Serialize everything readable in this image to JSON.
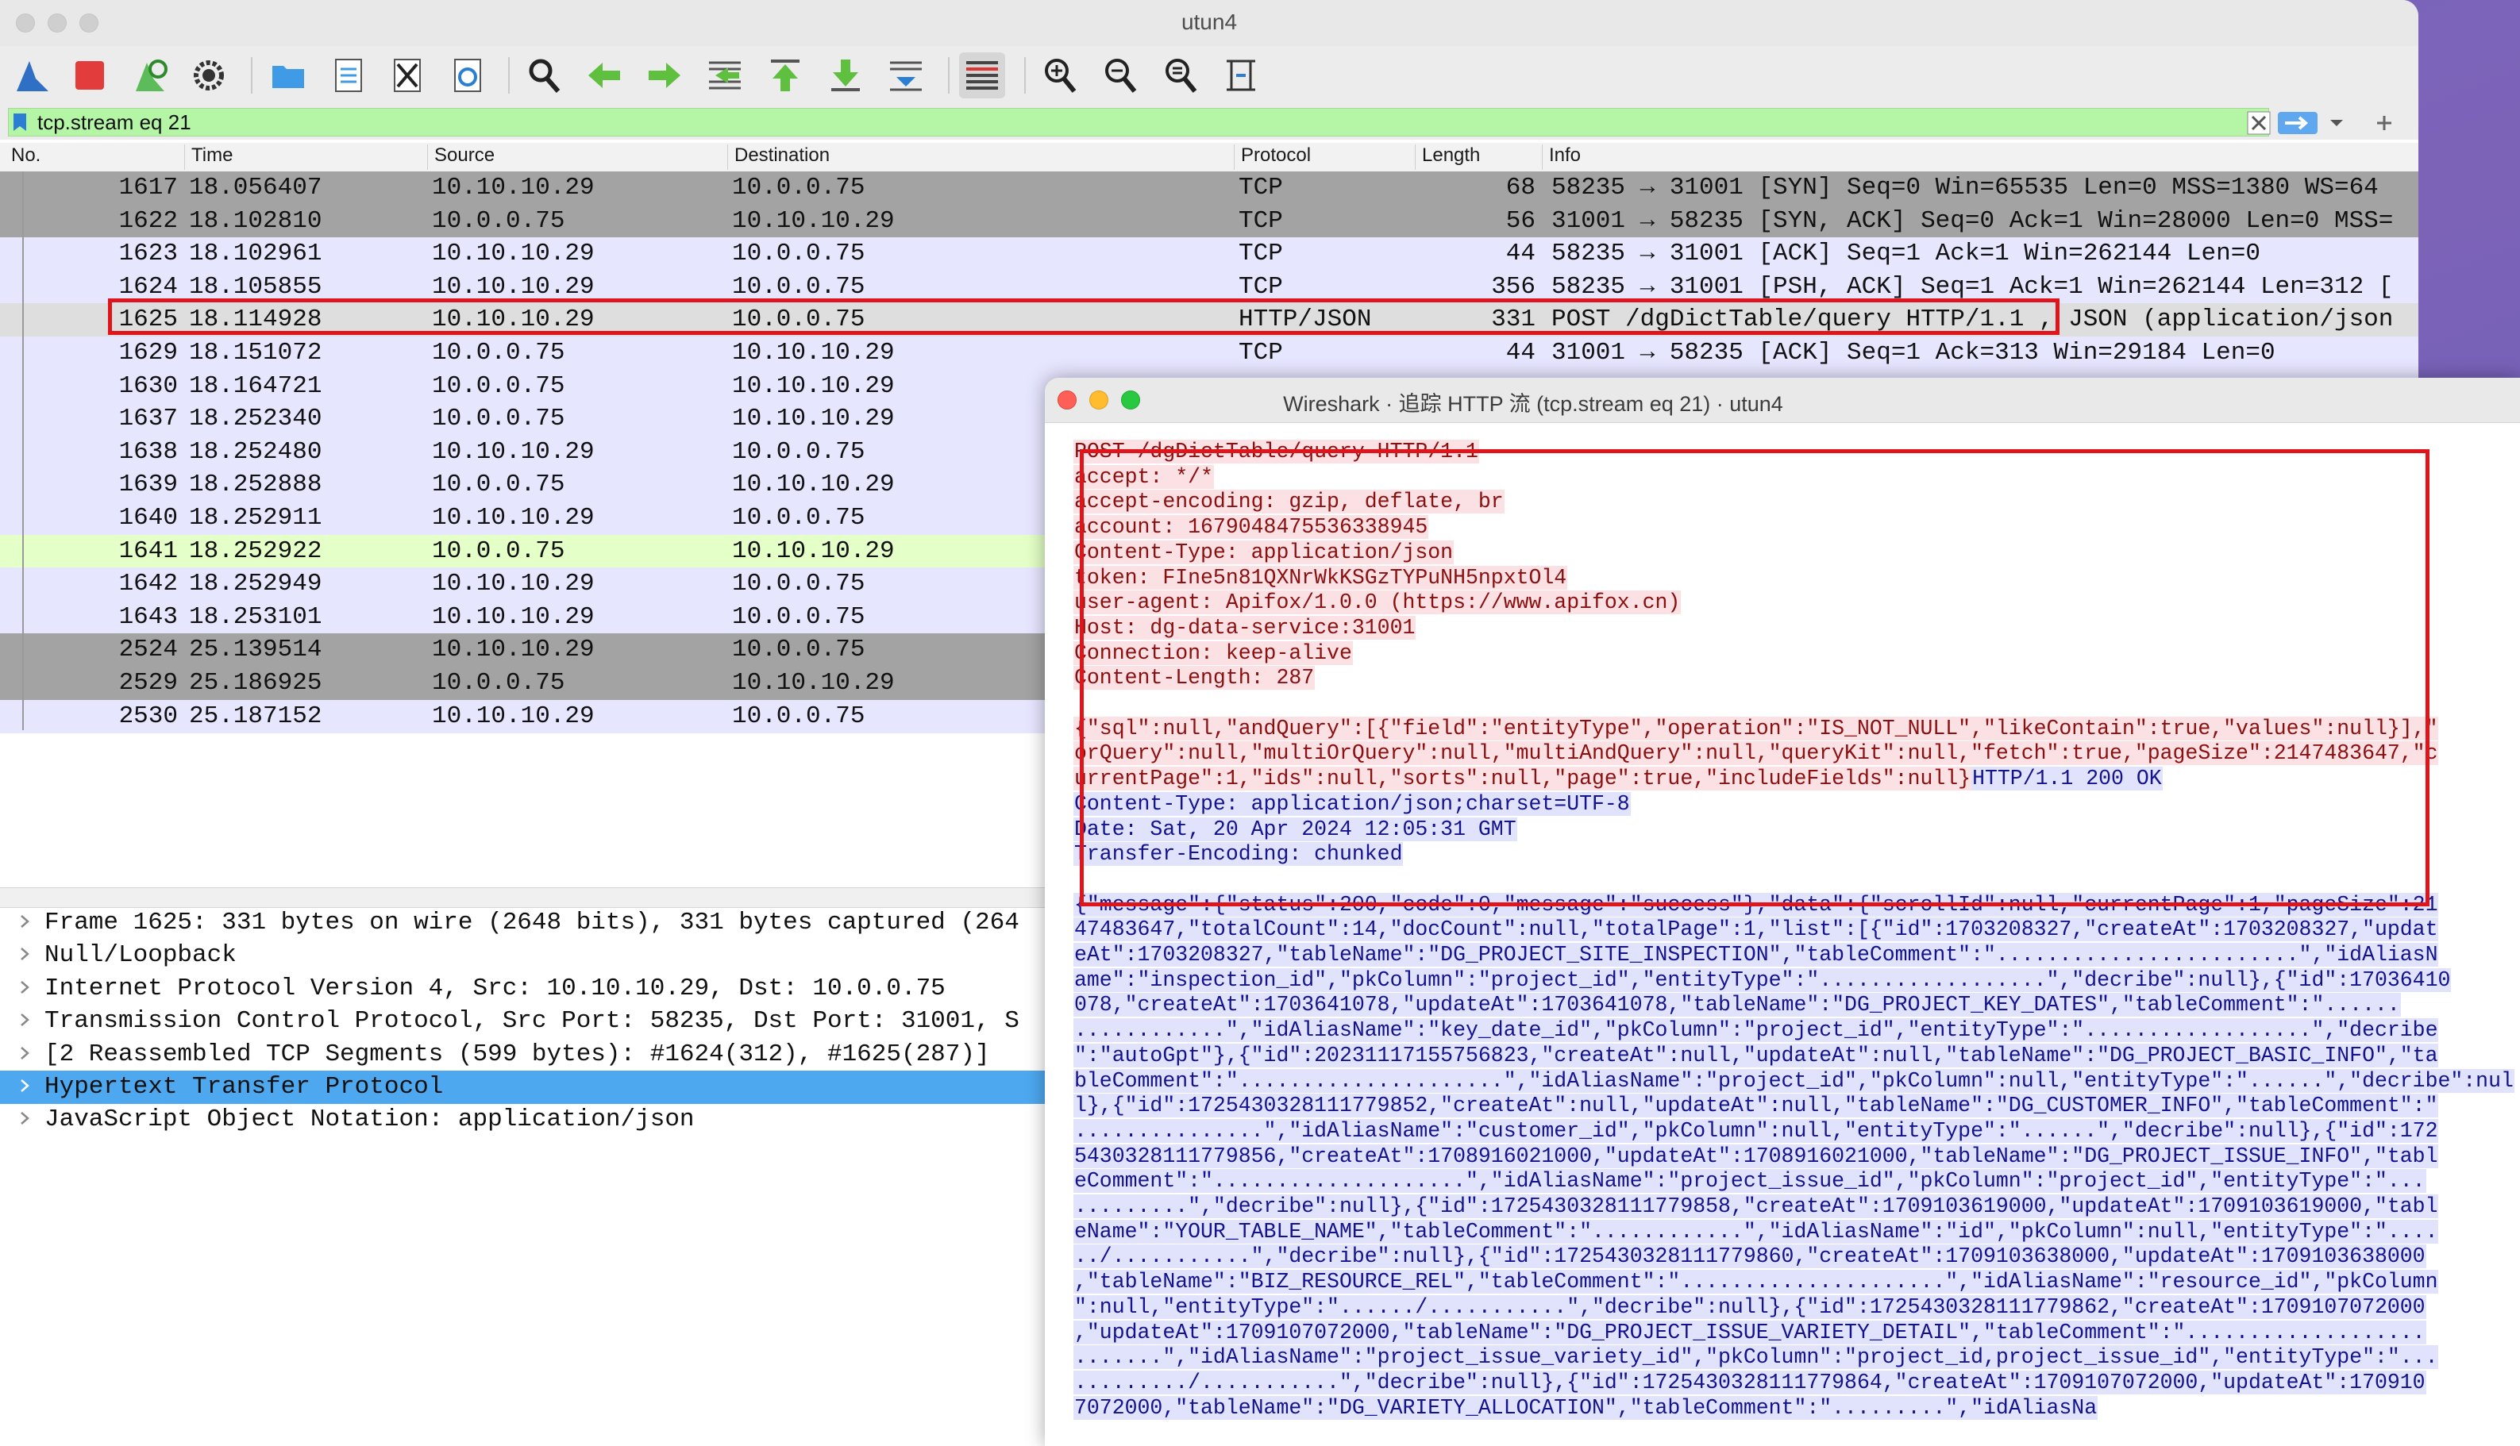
{
  "window": {
    "title": "utun4"
  },
  "toolbar": {
    "items": [
      "shark-fin-icon",
      "stop-icon",
      "restart-icon",
      "options-gear-icon",
      "open-folder-icon",
      "save-file-icon",
      "close-file-icon",
      "reload-icon",
      "find-icon",
      "go-back-icon",
      "go-forward-icon",
      "go-to-packet-icon",
      "first-packet-icon",
      "last-packet-icon",
      "autoscroll-icon",
      "colorize-icon",
      "zoom-in-icon",
      "zoom-out-icon",
      "zoom-normal-icon",
      "resize-columns-icon"
    ]
  },
  "filter": {
    "value": "tcp.stream eq 21",
    "bg_color": "#b5f5a6"
  },
  "packet_list": {
    "columns": [
      "No.",
      "Time",
      "Source",
      "Destination",
      "Protocol",
      "Length",
      "Info"
    ],
    "rows": [
      {
        "no": "1617",
        "time": "18.056407",
        "src": "10.10.10.29",
        "dst": "10.0.0.75",
        "proto": "TCP",
        "len": "68",
        "info": "58235 → 31001 [SYN] Seq=0 Win=65535 Len=0 MSS=1380 WS=64",
        "bg": "#a3a3a3"
      },
      {
        "no": "1622",
        "time": "18.102810",
        "src": "10.0.0.75",
        "dst": "10.10.10.29",
        "proto": "TCP",
        "len": "56",
        "info": "31001 → 58235 [SYN, ACK] Seq=0 Ack=1 Win=28000 Len=0 MSS=",
        "bg": "#a3a3a3"
      },
      {
        "no": "1623",
        "time": "18.102961",
        "src": "10.10.10.29",
        "dst": "10.0.0.75",
        "proto": "TCP",
        "len": "44",
        "info": "58235 → 31001 [ACK] Seq=1 Ack=1 Win=262144 Len=0",
        "bg": "#e7e6ff"
      },
      {
        "no": "1624",
        "time": "18.105855",
        "src": "10.10.10.29",
        "dst": "10.0.0.75",
        "proto": "TCP",
        "len": "356",
        "info": "58235 → 31001 [PSH, ACK] Seq=1 Ack=1 Win=262144 Len=312 [",
        "bg": "#e7e6ff"
      },
      {
        "no": "1625",
        "time": "18.114928",
        "src": "10.10.10.29",
        "dst": "10.0.0.75",
        "proto": "HTTP/JSON",
        "len": "331",
        "info": "POST /dgDictTable/query HTTP/1.1 , JSON (application/json",
        "bg": "#dedede"
      },
      {
        "no": "1629",
        "time": "18.151072",
        "src": "10.0.0.75",
        "dst": "10.10.10.29",
        "proto": "TCP",
        "len": "44",
        "info": "31001 → 58235 [ACK] Seq=1 Ack=313 Win=29184 Len=0",
        "bg": "#e7e6ff"
      },
      {
        "no": "1630",
        "time": "18.164721",
        "src": "10.0.0.75",
        "dst": "10.10.10.29",
        "proto": "",
        "len": "",
        "info": "",
        "bg": "#e7e6ff"
      },
      {
        "no": "1637",
        "time": "18.252340",
        "src": "10.0.0.75",
        "dst": "10.10.10.29",
        "proto": "",
        "len": "",
        "info": "",
        "bg": "#e7e6ff"
      },
      {
        "no": "1638",
        "time": "18.252480",
        "src": "10.10.10.29",
        "dst": "10.0.0.75",
        "proto": "",
        "len": "",
        "info": "",
        "bg": "#e7e6ff"
      },
      {
        "no": "1639",
        "time": "18.252888",
        "src": "10.0.0.75",
        "dst": "10.10.10.29",
        "proto": "",
        "len": "",
        "info": "",
        "bg": "#e7e6ff"
      },
      {
        "no": "1640",
        "time": "18.252911",
        "src": "10.10.10.29",
        "dst": "10.0.0.75",
        "proto": "",
        "len": "",
        "info": "",
        "bg": "#e7e6ff"
      },
      {
        "no": "1641",
        "time": "18.252922",
        "src": "10.0.0.75",
        "dst": "10.10.10.29",
        "proto": "",
        "len": "",
        "info": "",
        "bg": "#e4ffc7"
      },
      {
        "no": "1642",
        "time": "18.252949",
        "src": "10.10.10.29",
        "dst": "10.0.0.75",
        "proto": "",
        "len": "",
        "info": "",
        "bg": "#e7e6ff"
      },
      {
        "no": "1643",
        "time": "18.253101",
        "src": "10.10.10.29",
        "dst": "10.0.0.75",
        "proto": "",
        "len": "",
        "info": "",
        "bg": "#e7e6ff"
      },
      {
        "no": "2524",
        "time": "25.139514",
        "src": "10.10.10.29",
        "dst": "10.0.0.75",
        "proto": "",
        "len": "",
        "info": "",
        "bg": "#a3a3a3"
      },
      {
        "no": "2529",
        "time": "25.186925",
        "src": "10.0.0.75",
        "dst": "10.10.10.29",
        "proto": "",
        "len": "",
        "info": "",
        "bg": "#a3a3a3"
      },
      {
        "no": "2530",
        "time": "25.187152",
        "src": "10.10.10.29",
        "dst": "10.0.0.75",
        "proto": "",
        "len": "",
        "info": "",
        "bg": "#e7e6ff"
      }
    ]
  },
  "details": {
    "rows": [
      {
        "text": "Frame 1625: 331 bytes on wire (2648 bits), 331 bytes captured (264",
        "selected": false
      },
      {
        "text": "Null/Loopback",
        "selected": false
      },
      {
        "text": "Internet Protocol Version 4, Src: 10.10.10.29, Dst: 10.0.0.75",
        "selected": false
      },
      {
        "text": "Transmission Control Protocol, Src Port: 58235, Dst Port: 31001, S",
        "selected": false
      },
      {
        "text": "[2 Reassembled TCP Segments (599 bytes): #1624(312), #1625(287)]",
        "selected": false
      },
      {
        "text": "Hypertext Transfer Protocol",
        "selected": true
      },
      {
        "text": "JavaScript Object Notation: application/json",
        "selected": false
      }
    ]
  },
  "dialog": {
    "title": "Wireshark · 追踪 HTTP 流 (tcp.stream eq 21) · utun4",
    "client_color": "#8b0f0f",
    "server_color": "#13128f",
    "lines": [
      {
        "dir": "cli",
        "text": "POST /dgDictTable/query HTTP/1.1"
      },
      {
        "dir": "cli",
        "text": "accept: */*"
      },
      {
        "dir": "cli",
        "text": "accept-encoding: gzip, deflate, br"
      },
      {
        "dir": "cli",
        "text": "account: 1679048475536338945"
      },
      {
        "dir": "cli",
        "text": "Content-Type: application/json"
      },
      {
        "dir": "cli",
        "text": "token: FIne5n81QXNrWkKSGzTYPuNH5npxtOl4"
      },
      {
        "dir": "cli",
        "text": "user-agent: Apifox/1.0.0 (https://www.apifox.cn)"
      },
      {
        "dir": "cli",
        "text": "Host: dg-data-service:31001"
      },
      {
        "dir": "cli",
        "text": "Connection: keep-alive"
      },
      {
        "dir": "cli",
        "text": "Content-Length: 287"
      },
      {
        "dir": "blank",
        "text": ""
      },
      {
        "dir": "cli",
        "text": "{\"sql\":null,\"andQuery\":[{\"field\":\"entityType\",\"operation\":\"IS_NOT_NULL\",\"likeContain\":true,\"values\":null}],\""
      },
      {
        "dir": "cli",
        "text": "orQuery\":null,\"multiOrQuery\":null,\"multiAndQuery\":null,\"queryKit\":null,\"fetch\":true,\"pageSize\":2147483647,\"c"
      },
      {
        "dir": "mix",
        "text": "urrentPage\":1,\"ids\":null,\"sorts\":null,\"page\":true,\"includeFields\":null}",
        "text2": "HTTP/1.1 200 OK"
      },
      {
        "dir": "srv",
        "text": "Content-Type: application/json;charset=UTF-8"
      },
      {
        "dir": "srv",
        "text": "Date: Sat, 20 Apr 2024 12:05:31 GMT"
      },
      {
        "dir": "srv",
        "text": "Transfer-Encoding: chunked"
      },
      {
        "dir": "blank",
        "text": ""
      },
      {
        "dir": "srv",
        "text": "{\"message\":{\"status\":200,\"code\":0,\"message\":\"success\"},\"data\":{\"scrollId\":null,\"currentPage\":1,\"pageSize\":21"
      },
      {
        "dir": "srv",
        "text": "47483647,\"totalCount\":14,\"docCount\":null,\"totalPage\":1,\"list\":[{\"id\":1703208327,\"createAt\":1703208327,\"updat"
      },
      {
        "dir": "srv",
        "text": "eAt\":1703208327,\"tableName\":\"DG_PROJECT_SITE_INSPECTION\",\"tableComment\":\"........................\",\"idAliasN"
      },
      {
        "dir": "srv",
        "text": "ame\":\"inspection_id\",\"pkColumn\":\"project_id\",\"entityType\":\"..................\",\"decribe\":null},{\"id\":17036410"
      },
      {
        "dir": "srv",
        "text": "078,\"createAt\":1703641078,\"updateAt\":1703641078,\"tableName\":\"DG_PROJECT_KEY_DATES\",\"tableComment\":\"......"
      },
      {
        "dir": "srv",
        "text": "............\",\"idAliasName\":\"key_date_id\",\"pkColumn\":\"project_id\",\"entityType\":\"..................\",\"decribe"
      },
      {
        "dir": "srv",
        "text": "\":\"autoGpt\"},{\"id\":20231117155756823,\"createAt\":null,\"updateAt\":null,\"tableName\":\"DG_PROJECT_BASIC_INFO\",\"ta"
      },
      {
        "dir": "srv",
        "text": "bleComment\":\".....................\",\"idAliasName\":\"project_id\",\"pkColumn\":null,\"entityType\":\"......\",\"decribe\":nul"
      },
      {
        "dir": "srv",
        "text": "l},{\"id\":1725430328111779852,\"createAt\":null,\"updateAt\":null,\"tableName\":\"DG_CUSTOMER_INFO\",\"tableComment\":\""
      },
      {
        "dir": "srv",
        "text": "...............\",\"idAliasName\":\"customer_id\",\"pkColumn\":null,\"entityType\":\"......\",\"decribe\":null},{\"id\":172"
      },
      {
        "dir": "srv",
        "text": "5430328111779856,\"createAt\":1708916021000,\"updateAt\":1708916021000,\"tableName\":\"DG_PROJECT_ISSUE_INFO\",\"tabl"
      },
      {
        "dir": "srv",
        "text": "eComment\":\"....................\",\"idAliasName\":\"project_issue_id\",\"pkColumn\":\"project_id\",\"entityType\":\"..."
      },
      {
        "dir": "srv",
        "text": ".........\",\"decribe\":null},{\"id\":1725430328111779858,\"createAt\":1709103619000,\"updateAt\":1709103619000,\"tabl"
      },
      {
        "dir": "srv",
        "text": "eName\":\"YOUR_TABLE_NAME\",\"tableComment\":\"............\",\"idAliasName\":\"id\",\"pkColumn\":null,\"entityType\":\"...."
      },
      {
        "dir": "srv",
        "text": "../...........\",\"decribe\":null},{\"id\":1725430328111779860,\"createAt\":1709103638000,\"updateAt\":1709103638000"
      },
      {
        "dir": "srv",
        "text": ",\"tableName\":\"BIZ_RESOURCE_REL\",\"tableComment\":\".....................\",\"idAliasName\":\"resource_id\",\"pkColumn"
      },
      {
        "dir": "srv",
        "text": "\":null,\"entityType\":\"....../...........\",\"decribe\":null},{\"id\":1725430328111779862,\"createAt\":1709107072000"
      },
      {
        "dir": "srv",
        "text": ",\"updateAt\":1709107072000,\"tableName\":\"DG_PROJECT_ISSUE_VARIETY_DETAIL\",\"tableComment\":\"..................."
      },
      {
        "dir": "srv",
        "text": ".......\",\"idAliasName\":\"project_issue_variety_id\",\"pkColumn\":\"project_id,project_issue_id\",\"entityType\":\"..."
      },
      {
        "dir": "srv",
        "text": "........./...........\",\"decribe\":null},{\"id\":1725430328111779864,\"createAt\":1709107072000,\"updateAt\":170910"
      },
      {
        "dir": "srv",
        "text": "7072000,\"tableName\":\"DG_VARIETY_ALLOCATION\",\"tableComment\":\".........\",\"idAliasNa"
      }
    ]
  }
}
